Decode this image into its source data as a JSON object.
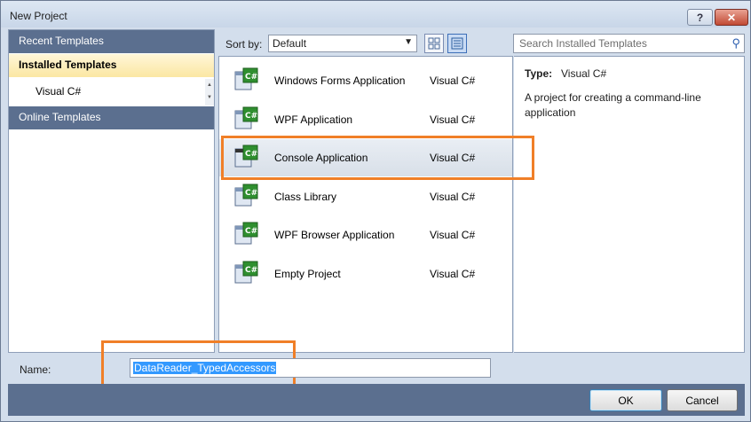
{
  "window": {
    "title": "New Project",
    "help_label": "?",
    "close_label": "✕"
  },
  "sidebar": {
    "recent_label": "Recent Templates",
    "installed_label": "Installed Templates",
    "sub_item": "Visual C#",
    "online_label": "Online Templates"
  },
  "toolbar": {
    "sort_label": "Sort by:",
    "sort_value": "Default",
    "search_placeholder": "Search Installed Templates"
  },
  "templates": [
    {
      "name": "Windows Forms Application",
      "lang": "Visual C#",
      "icon": "windows-forms-icon"
    },
    {
      "name": "WPF Application",
      "lang": "Visual C#",
      "icon": "wpf-icon"
    },
    {
      "name": "Console Application",
      "lang": "Visual C#",
      "icon": "console-icon",
      "selected": true
    },
    {
      "name": "Class Library",
      "lang": "Visual C#",
      "icon": "class-library-icon"
    },
    {
      "name": "WPF Browser Application",
      "lang": "Visual C#",
      "icon": "wpf-browser-icon"
    },
    {
      "name": "Empty Project",
      "lang": "Visual C#",
      "icon": "empty-project-icon"
    }
  ],
  "details": {
    "type_label": "Type:",
    "type_value": "Visual C#",
    "description": "A project for creating a command-line application"
  },
  "form": {
    "name_label": "Name:",
    "name_value": "DataReader_TypedAccessors"
  },
  "buttons": {
    "ok": "OK",
    "cancel": "Cancel"
  },
  "colors": {
    "highlight": "#f07f28",
    "header": "#5b6f8f",
    "selection": "#3399ff"
  }
}
